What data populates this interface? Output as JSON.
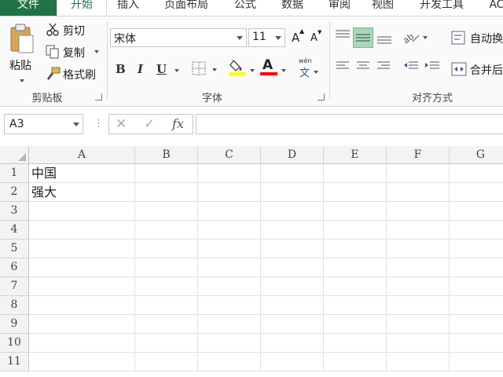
{
  "tabs": {
    "file": "文件",
    "items": [
      "开始",
      "插入",
      "页面布局",
      "公式",
      "数据",
      "审阅",
      "视图",
      "开发工具",
      "AC"
    ]
  },
  "clipboard": {
    "paste": "粘贴",
    "cut": "剪切",
    "copy": "复制",
    "format_painter": "格式刷",
    "group_label": "剪贴板"
  },
  "font": {
    "name": "宋体",
    "size": "11",
    "bold": "B",
    "italic": "I",
    "underline": "U",
    "grow": "A",
    "shrink": "A",
    "font_color_letter": "A",
    "phonetic": "文",
    "phonetic_top": "wén",
    "group_label": "字体",
    "fill_color": "#ffff00",
    "text_color": "#ff0000"
  },
  "alignment": {
    "wrap_text": "自动换",
    "merge_center": "合并后",
    "group_label": "对齐方式"
  },
  "formula_bar": {
    "name_box": "A3",
    "fx": "fx",
    "cancel": "✕",
    "enter": "✓",
    "formula": ""
  },
  "grid": {
    "columns": [
      "A",
      "B",
      "C",
      "D",
      "E",
      "F",
      "G"
    ],
    "rows": [
      "1",
      "2",
      "3",
      "4",
      "5",
      "6",
      "7",
      "8",
      "9",
      "10",
      "11"
    ],
    "cells": {
      "A1": "中国",
      "A2": "强大"
    }
  },
  "colors": {
    "accent": "#217346",
    "selected_align": "#a9d6b9"
  }
}
